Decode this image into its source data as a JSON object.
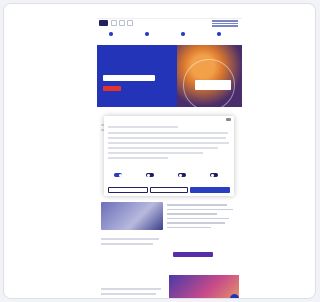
{
  "site": {
    "logo_text": "",
    "top_alert": "",
    "nav_items": [
      {
        "label": ""
      },
      {
        "label": ""
      },
      {
        "label": ""
      },
      {
        "label": ""
      }
    ]
  },
  "hero": {
    "title": "",
    "input_placeholder": "",
    "button_label": ""
  },
  "main": {
    "section_title": "",
    "promo_title": ""
  },
  "cookie_banner": {
    "title": "",
    "toggles": [
      {
        "label": "",
        "on": true
      },
      {
        "label": "",
        "on": false
      },
      {
        "label": "",
        "on": false
      },
      {
        "label": "",
        "on": false
      }
    ],
    "details_link": "",
    "buttons": {
      "decline": "",
      "save": "",
      "accept": ""
    }
  },
  "colors": {
    "primary": "#2334b8",
    "dark_navy": "#20215e",
    "alert_red": "#d0322d",
    "accent_purple": "#5a2da8"
  }
}
